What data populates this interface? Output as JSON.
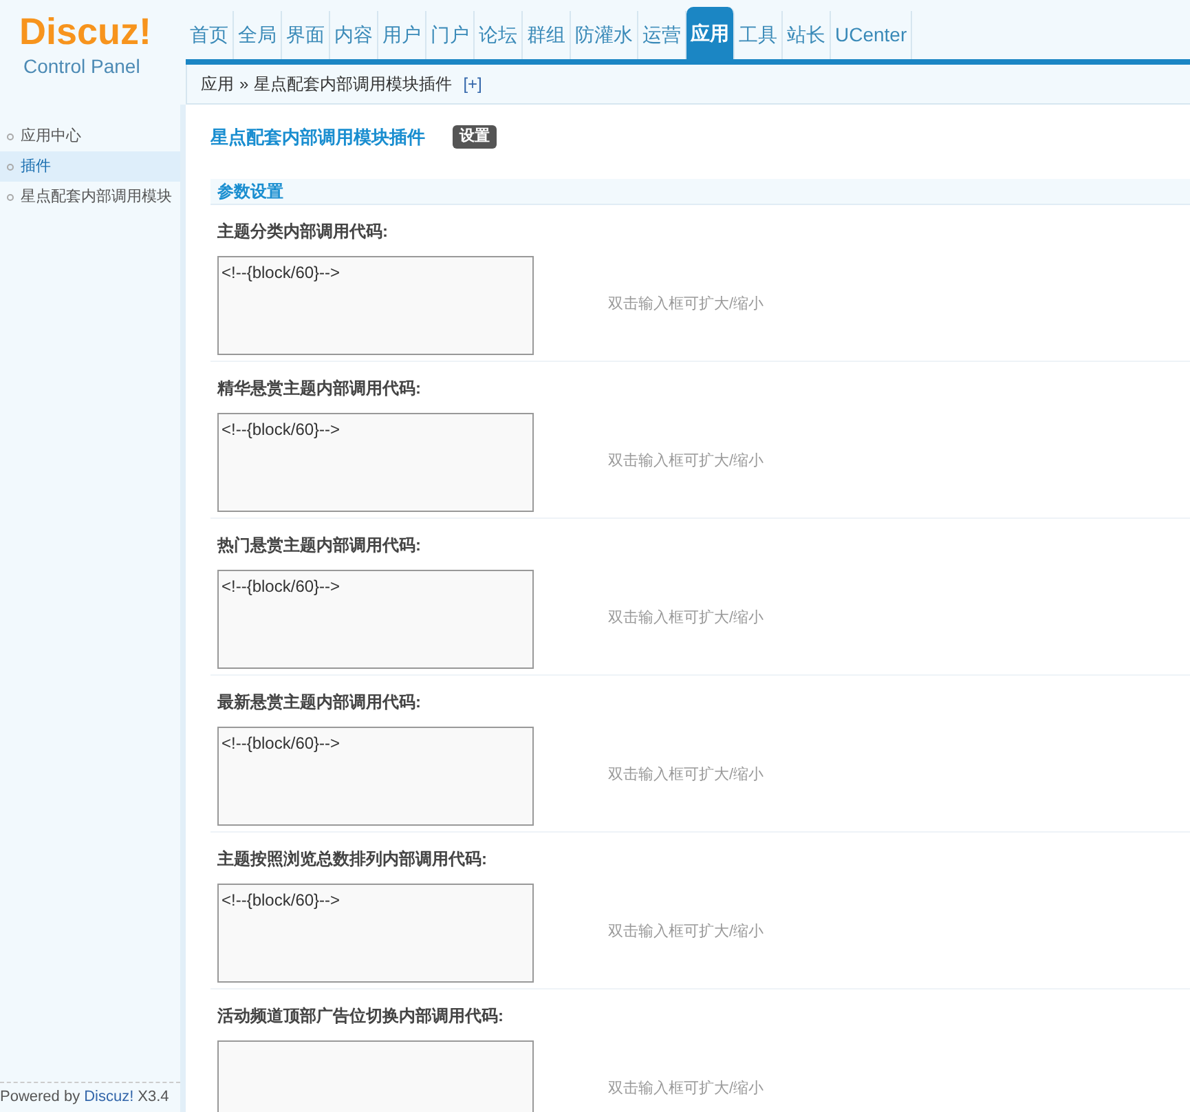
{
  "logo": {
    "brand": "Discuz!",
    "subtitle": "Control Panel"
  },
  "nav": [
    {
      "label": "首页",
      "selected": false
    },
    {
      "label": "全局",
      "selected": false
    },
    {
      "label": "界面",
      "selected": false
    },
    {
      "label": "内容",
      "selected": false
    },
    {
      "label": "用户",
      "selected": false
    },
    {
      "label": "门户",
      "selected": false
    },
    {
      "label": "论坛",
      "selected": false
    },
    {
      "label": "群组",
      "selected": false
    },
    {
      "label": "防灌水",
      "selected": false
    },
    {
      "label": "运营",
      "selected": false
    },
    {
      "label": "应用",
      "selected": true
    },
    {
      "label": "工具",
      "selected": false
    },
    {
      "label": "站长",
      "selected": false
    },
    {
      "label": "UCenter",
      "selected": false
    }
  ],
  "breadcrumb": {
    "items": [
      "应用",
      "星点配套内部调用模块插件"
    ],
    "separator": "»",
    "add": "[+]"
  },
  "sidebar": {
    "items": [
      {
        "label": "应用中心",
        "selected": false
      },
      {
        "label": "插件",
        "selected": true
      },
      {
        "label": "星点配套内部调用模块",
        "selected": false
      }
    ],
    "footer": {
      "prefix": "Powered by",
      "brand": "Discuz!",
      "version": "X3.4"
    }
  },
  "page": {
    "title": "星点配套内部调用模块插件",
    "tab": "设置",
    "section": "参数设置"
  },
  "fields": [
    {
      "label": "主题分类内部调用代码:",
      "value": "<!--{block/60}-->",
      "hint": "双击输入框可扩大/缩小"
    },
    {
      "label": "精华悬赏主题内部调用代码:",
      "value": "<!--{block/60}-->",
      "hint": "双击输入框可扩大/缩小"
    },
    {
      "label": "热门悬赏主题内部调用代码:",
      "value": "<!--{block/60}-->",
      "hint": "双击输入框可扩大/缩小"
    },
    {
      "label": "最新悬赏主题内部调用代码:",
      "value": "<!--{block/60}-->",
      "hint": "双击输入框可扩大/缩小"
    },
    {
      "label": "主题按照浏览总数排列内部调用代码:",
      "value": "<!--{block/60}-->",
      "hint": "双击输入框可扩大/缩小"
    },
    {
      "label": "活动频道顶部广告位切换内部调用代码:",
      "hint": "双击输入框可扩大/缩小"
    }
  ]
}
